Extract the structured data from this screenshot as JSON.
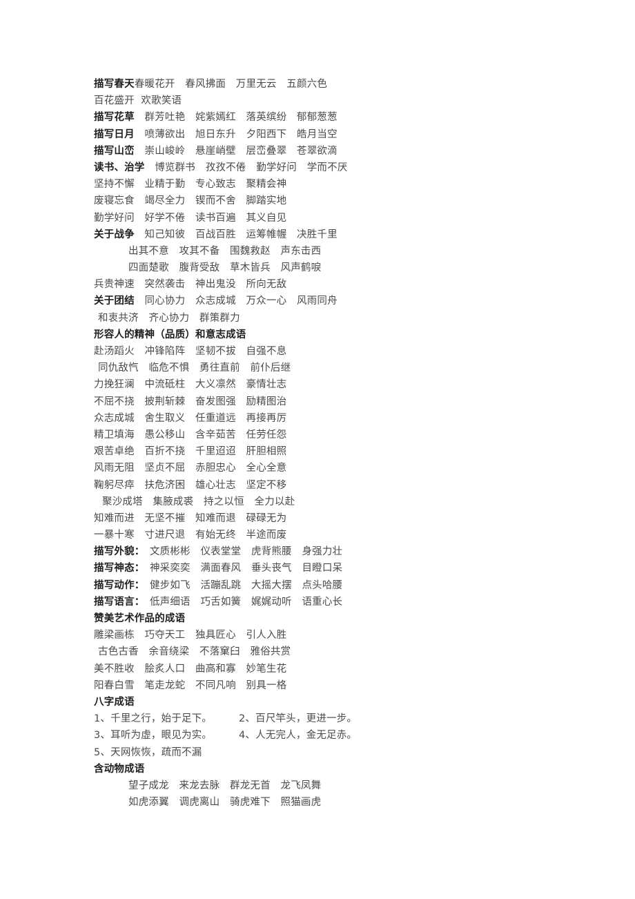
{
  "document": {
    "language": "zh-CN",
    "text_color": "#4a4a4a",
    "heading_color": "#1e1e1e",
    "background_color": "#ffffff"
  },
  "blocks": {
    "spring": {
      "label": "描写春天",
      "items": "春暖花开　春风拂面　万里无云　五颜六色",
      "continuation": "百花盛开  欢歌笑语"
    },
    "flowers": {
      "label": "描写花草",
      "items": "　群芳吐艳　姹紫嫣红　落英缤纷　郁郁葱葱"
    },
    "sun_moon": {
      "label": "描写日月",
      "items": "　喷薄欲出　旭日东升　夕阳西下　皓月当空"
    },
    "mountains": {
      "label": "描写山峦",
      "items": "　崇山峻岭　悬崖峭壁　层峦叠翠　苍翠欲滴"
    },
    "study": {
      "label": "读书、治学",
      "items": "　博览群书　孜孜不倦　勤学好问　学而不厌",
      "lines": [
        "坚持不懈　业精于勤　专心致志　聚精会神",
        "废寝忘食　竭尽全力　锲而不舍　脚踏实地",
        "勤学好问　好学不倦　读书百遍　其义自见"
      ]
    },
    "war": {
      "label": "关于战争",
      "items": "　知己知彼　百战百胜　运筹帷幄　决胜千里",
      "indented_lines": [
        "出其不意　攻其不备　围魏救赵　声东击西",
        "四面楚歌　腹背受敌　草木皆兵　风声鹤唳"
      ],
      "trailing_line": "兵贵神速　突然袭击　神出鬼没　所向无敌"
    },
    "unity": {
      "label": "关于团结",
      "items": "　同心协力　众志成城　万众一心　风雨同舟",
      "continuation": "和衷共济　齐心协力　群策群力"
    },
    "spirit": {
      "heading": "形容人的精神（品质）和意志成语",
      "lines": [
        "赴汤蹈火　冲锋陷阵　坚韧不拔　自强不息",
        "同仇敌忾　临危不惧　勇往直前　前仆后继",
        "力挽狂澜　中流砥柱　大义凛然　豪情壮志",
        "不屈不挠　披荆斩棘　奋发图强　励精图治",
        "众志成城　舍生取义　任重道远　再接再厉",
        "精卫填海　愚公移山　含辛茹苦　任劳任怨",
        "艰苦卓绝　百折不挠　千里迢迢　肝胆相照",
        "风雨无阻　坚贞不屈　赤胆忠心　全心全意",
        "鞠躬尽瘁　扶危济困　雄心壮志　坚定不移"
      ],
      "indented_line": "聚沙成塔　集腋成裘　持之以恒　全力以赴",
      "tail_lines": [
        "知难而进　无坚不摧　知难而退　碌碌无为",
        "一暴十寒　寸进尺退　有始无终　半途而废"
      ]
    },
    "appearance": {
      "label": "描写外貌：",
      "items": "　文质彬彬　仪表堂堂　虎背熊腰　身强力壮"
    },
    "expression": {
      "label": "描写神态：",
      "items": "　神采奕奕　满面春风　垂头丧气　目瞪口呆"
    },
    "action": {
      "label": "描写动作：",
      "items": "　健步如飞　活蹦乱跳　大摇大摆　点头哈腰"
    },
    "speech": {
      "label": "描写语言：",
      "items": "　低声细语　巧舌如簧　娓娓动听　语重心长"
    },
    "art": {
      "heading": "赞美艺术作品的成语",
      "lines": [
        "雕梁画栋　巧夺天工　独具匠心　引人入胜"
      ],
      "indented_line": "古色古香　余音绕梁　不落窠臼　雅俗共赏",
      "tail_lines": [
        "美不胜收　脍炙人口　曲高和寡　妙笔生花",
        "阳春白雪　笔走龙蛇　不同凡响　别具一格"
      ]
    },
    "eight_char": {
      "heading": "八字成语",
      "rows": [
        {
          "left": "1、千里之行，始于足下。",
          "right": "2、百尺竿头，更进一步。"
        },
        {
          "left": "3、耳听为虚，眼见为实。",
          "right": "4、人无完人，金无足赤。"
        },
        {
          "left": "5、天网恢恢，疏而不漏",
          "right": ""
        }
      ]
    },
    "animals": {
      "heading": "含动物成语",
      "lines": [
        "望子成龙　来龙去脉　群龙无首　龙飞凤舞",
        "如虎添翼　调虎离山　骑虎难下　照猫画虎"
      ]
    }
  }
}
